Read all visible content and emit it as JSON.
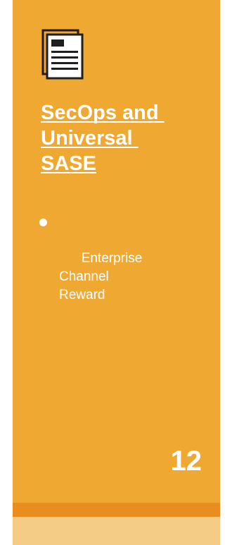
{
  "card": {
    "icon": "document-icon",
    "title": "SecOps and \nUniversal \nSASE",
    "bullets": [
      {
        "text": "Enterprise\nChannel\nReward"
      }
    ],
    "count": "12",
    "progress": 1.0
  },
  "colors": {
    "card_background": "#efa932",
    "progress_fill": "#e98d1e",
    "progress_track": "#f4cc85",
    "text": "#ffffff"
  }
}
